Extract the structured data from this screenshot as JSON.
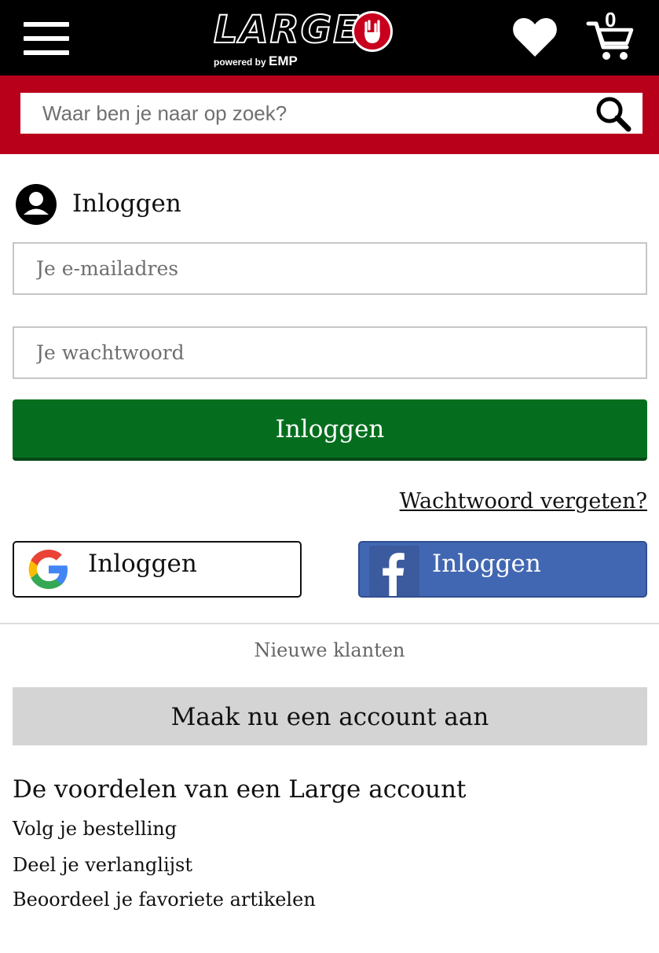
{
  "header": {
    "logo_text": "LARGE",
    "logo_sub_prefix": "powered by ",
    "logo_sub_brand": "EMP",
    "cart_count": "0",
    "brand_color": "#b8001a",
    "icons": [
      "menu-icon",
      "heart-icon",
      "cart-icon",
      "search-icon"
    ]
  },
  "search": {
    "placeholder": "Waar ben je naar op zoek?"
  },
  "login": {
    "title": "Inloggen",
    "email_placeholder": "Je e-mailadres",
    "password_placeholder": "Je wachtwoord",
    "submit_label": "Inloggen",
    "submit_color": "#056e1e",
    "forgot_label": "Wachtwoord vergeten?"
  },
  "social": {
    "google_label": "Inloggen",
    "facebook_label": "Inloggen",
    "facebook_color": "#4267b2"
  },
  "register": {
    "section_label": "Nieuwe klanten",
    "create_label": "Maak nu een account aan"
  },
  "benefits": {
    "title": "De voordelen van een Large account",
    "items": [
      "Volg je bestelling",
      "Deel je verlanglijst",
      "Beoordeel je favoriete artikelen"
    ]
  }
}
